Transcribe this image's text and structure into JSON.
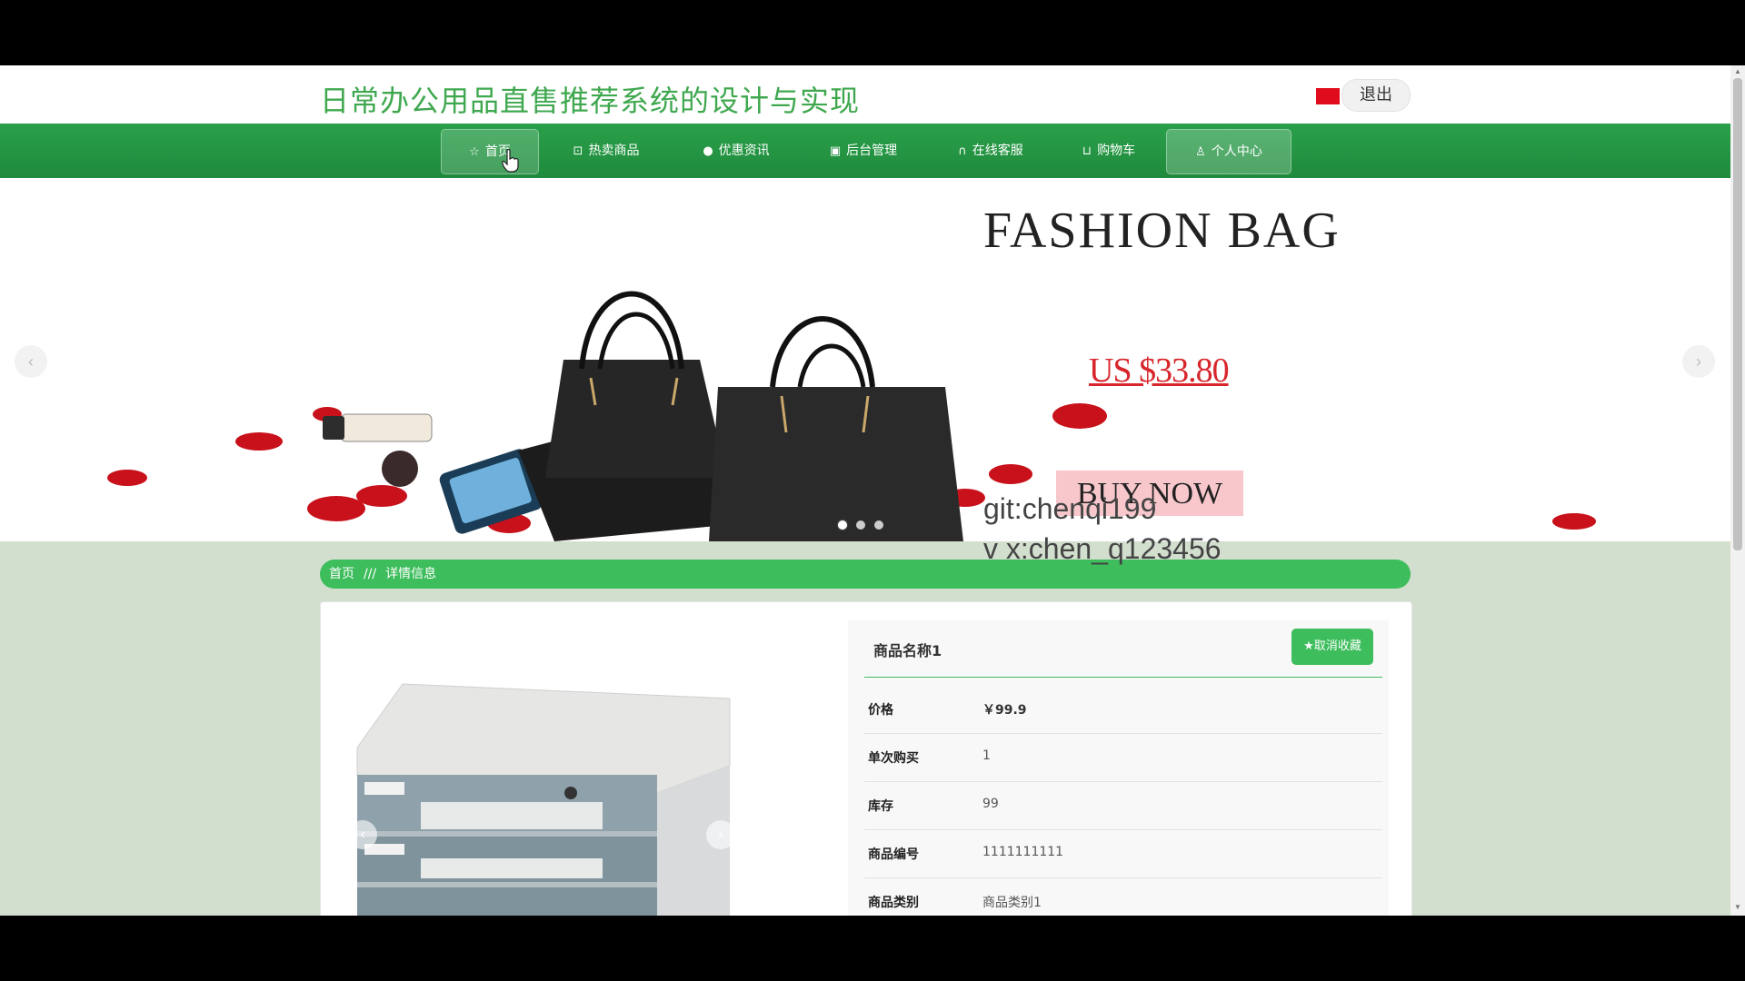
{
  "header": {
    "title": "日常办公用品直售推荐系统的设计与实现",
    "logout_label": "退出"
  },
  "nav": {
    "items": [
      {
        "label": "首页",
        "icon": "star-icon"
      },
      {
        "label": "热卖商品",
        "icon": "bag-icon"
      },
      {
        "label": "优惠资讯",
        "icon": "info-icon"
      },
      {
        "label": "后台管理",
        "icon": "admin-icon"
      },
      {
        "label": "在线客服",
        "icon": "headset-icon"
      },
      {
        "label": "购物车",
        "icon": "cart-icon"
      },
      {
        "label": "个人中心",
        "icon": "user-icon"
      }
    ]
  },
  "banner": {
    "title": "FASHION BAG",
    "price": "US $33.80",
    "cta": "BUY NOW",
    "slides": 3,
    "active_slide": 1
  },
  "watermark": {
    "line1": "git:chenqi199",
    "line2": "v x:chen_q123456"
  },
  "breadcrumb": {
    "home": "首页",
    "separator": "///",
    "current": "详情信息"
  },
  "product": {
    "name": "商品名称1",
    "favorite_label": "★取消收藏",
    "fields": [
      {
        "label": "价格",
        "value": "￥99.9"
      },
      {
        "label": "单次购买",
        "value": "1"
      },
      {
        "label": "库存",
        "value": "99"
      },
      {
        "label": "商品编号",
        "value": "1111111111"
      },
      {
        "label": "商品类别",
        "value": "商品类别1"
      }
    ]
  },
  "colors": {
    "brand_green": "#2aa04a",
    "accent_green": "#3dbd5c",
    "title_green": "#3fa84f",
    "price_red": "#d7262c"
  }
}
